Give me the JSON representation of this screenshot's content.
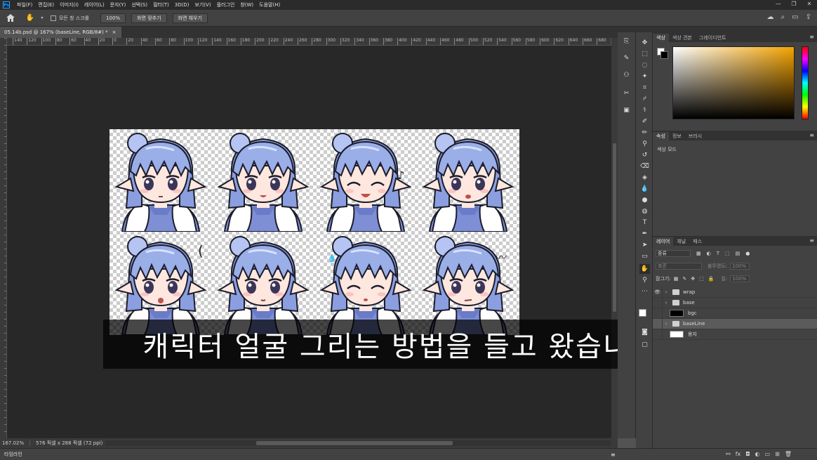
{
  "app": {
    "logo": "Ps",
    "menu": [
      "파일(F)",
      "편집(E)",
      "이미지(I)",
      "레이어(L)",
      "문자(Y)",
      "선택(S)",
      "필터(T)",
      "3D(D)",
      "보기(V)",
      "플러그인",
      "창(W)",
      "도움말(H)"
    ],
    "window_controls": [
      "—",
      "❐",
      "✕"
    ]
  },
  "options_bar": {
    "scroll_all_label": "모든 창 스크롤",
    "zoom_value": "100%",
    "fit_screen_label": "화면 맞추기",
    "fill_screen_label": "화면 채우기"
  },
  "document": {
    "tab_title": "05.14b.psd @ 167% (baseLine, RGB/8#) *",
    "close_glyph": "×",
    "ruler_ticks": [
      "140",
      "120",
      "100",
      "80",
      "60",
      "40",
      "20",
      "0",
      "20",
      "40",
      "60",
      "80",
      "100",
      "120",
      "140",
      "160",
      "180",
      "200",
      "220",
      "240",
      "260",
      "280",
      "300",
      "320",
      "340",
      "360",
      "380",
      "400",
      "420",
      "440",
      "460",
      "480",
      "500",
      "520",
      "540",
      "560",
      "580",
      "600",
      "620",
      "640",
      "660",
      "680"
    ]
  },
  "status": {
    "zoom": "167.02%",
    "doc_info": "576 픽셀 x 288 픽셀 (72 ppi)",
    "arrow": "›"
  },
  "timeline": {
    "label": "타임라인"
  },
  "subtitle": {
    "text": "캐릭터 얼굴 그리는 방법을 들고 왔습니다"
  },
  "panels": {
    "color_tabs": [
      "색상",
      "색상 견본",
      "그레이디언트"
    ],
    "props_tabs": [
      "속성",
      "정보",
      "브러시"
    ],
    "props_content": "색상 모드",
    "layer_tabs": [
      "레이어",
      "채널",
      "패스"
    ],
    "filter_kind": "종류",
    "blend_mode": "표준",
    "opacity_label": "불투명도:",
    "opacity_value": "100%",
    "lock_label": "잠그기:",
    "fill_label": "칠:",
    "fill_value": "100%",
    "layers": [
      {
        "name": "wrap",
        "kind": "group",
        "visible": true
      },
      {
        "name": "base",
        "kind": "group",
        "visible": false
      },
      {
        "name": "bgc",
        "kind": "fill-black",
        "visible": false
      },
      {
        "name": "baseLine",
        "kind": "group",
        "visible": false,
        "selected": true
      },
      {
        "name": "용지",
        "kind": "fill-white",
        "visible": false
      }
    ],
    "bottom_icons": [
      "link-icon",
      "fx-icon",
      "mask-icon",
      "adjustment-icon",
      "group-icon",
      "new-layer-icon",
      "delete-icon"
    ]
  },
  "colors": {
    "accent": "#31a8ff",
    "hair": "#8b9fe0",
    "hair_light": "#b5c4f2",
    "skin": "#fde7df",
    "outfit": "#7e8fd6"
  },
  "canvas_faces": [
    {
      "expression": "neutral",
      "mark": ""
    },
    {
      "expression": "smile",
      "mark": ""
    },
    {
      "expression": "happy-closed",
      "mark": "♪"
    },
    {
      "expression": "talking",
      "mark": ""
    },
    {
      "expression": "worried",
      "mark": "("
    },
    {
      "expression": "calm",
      "mark": ""
    },
    {
      "expression": "sweat-closed",
      "mark": "💧"
    },
    {
      "expression": "annoyed",
      "mark": "〰"
    }
  ]
}
